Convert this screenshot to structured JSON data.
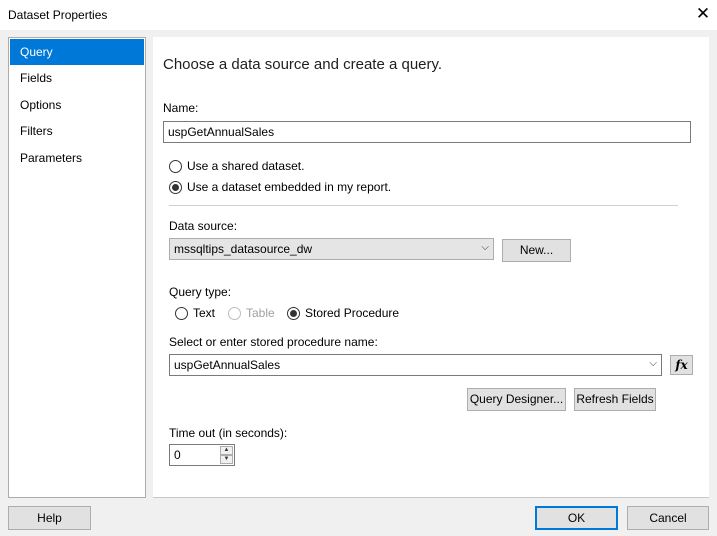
{
  "window": {
    "title": "Dataset Properties",
    "close_glyph": "✕"
  },
  "nav": {
    "items": [
      {
        "label": "Query",
        "selected": true
      },
      {
        "label": "Fields"
      },
      {
        "label": "Options"
      },
      {
        "label": "Filters"
      },
      {
        "label": "Parameters"
      }
    ]
  },
  "query": {
    "heading": "Choose a data source and create a query.",
    "name_label": "Name:",
    "name_value": "uspGetAnnualSales",
    "radio_shared": "Use a shared dataset.",
    "radio_embedded": "Use a dataset embedded in my report.",
    "datasource_label": "Data source:",
    "datasource_value": "mssqltips_datasource_dw",
    "new_button": "New...",
    "query_type_label": "Query type:",
    "qt_text": "Text",
    "qt_table": "Table",
    "qt_sp": "Stored Procedure",
    "sp_label": "Select or enter stored procedure name:",
    "sp_value": "uspGetAnnualSales",
    "fx_label": "fx",
    "query_designer_button": "Query Designer...",
    "refresh_fields_button": "Refresh Fields",
    "timeout_label": "Time out (in seconds):",
    "timeout_value": "0"
  },
  "footer": {
    "help": "Help",
    "ok": "OK",
    "cancel": "Cancel"
  },
  "colors": {
    "accent": "#0078d7"
  }
}
